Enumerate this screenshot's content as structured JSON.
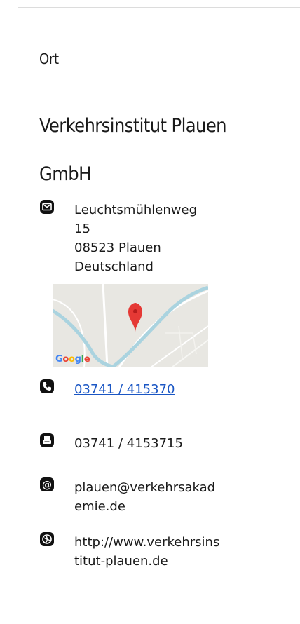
{
  "section": {
    "label": "Ort"
  },
  "company": {
    "name": "Verkehrsinstitut Plauen GmbH"
  },
  "address": {
    "street": "Leuchtsmühlenweg",
    "number": "15",
    "postal_city": "08523 Plauen",
    "country": "Deutschland"
  },
  "map": {
    "brand_letters": [
      "G",
      "o",
      "o",
      "g",
      "l",
      "e"
    ],
    "brand_colors": [
      "#4285f4",
      "#ea4335",
      "#fbbc05",
      "#4285f4",
      "#34a853",
      "#ea4335"
    ],
    "pin_color": "#e53935",
    "river_color": "#aad3df"
  },
  "phone": {
    "value": "03741 / 415370",
    "icon": "phone-icon"
  },
  "fax": {
    "value": "03741 / 4153715",
    "icon": "fax-icon"
  },
  "email": {
    "value": "plauen@verkehrsakademie.de",
    "icon": "at-icon"
  },
  "website": {
    "value": "http://www.verkehrsinstitut-plauen.de",
    "icon": "globe-icon"
  },
  "colors": {
    "text": "#1a1a1a",
    "link": "#1a56c4",
    "border": "#dcdcdc"
  }
}
